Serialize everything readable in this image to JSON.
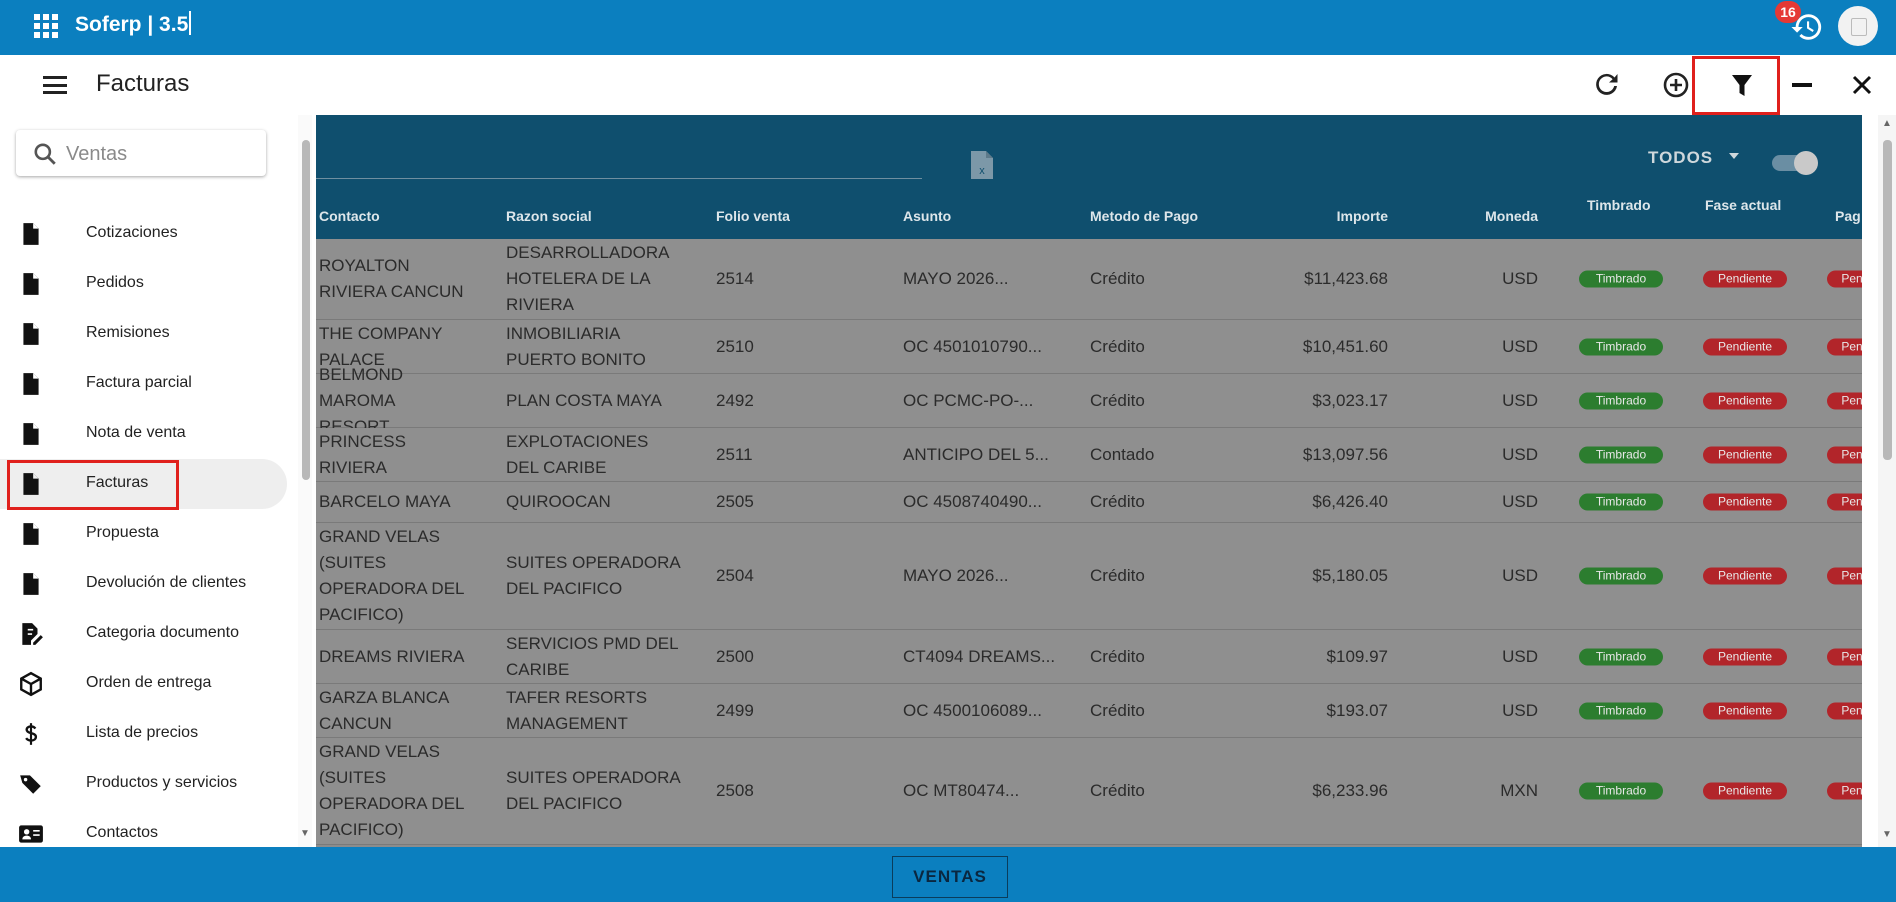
{
  "app": {
    "title": "Soferp | 3.5",
    "notification_count": "16"
  },
  "page": {
    "title": "Facturas"
  },
  "toolbar": {
    "icons": [
      "refresh-icon",
      "add-circle-icon",
      "filter-icon",
      "minimize-icon",
      "close-icon"
    ]
  },
  "sidebar": {
    "search_placeholder": "Ventas",
    "items": [
      {
        "label": "Cotizaciones",
        "icon": "document-icon"
      },
      {
        "label": "Pedidos",
        "icon": "document-icon"
      },
      {
        "label": "Remisiones",
        "icon": "document-icon"
      },
      {
        "label": "Factura parcial",
        "icon": "document-icon"
      },
      {
        "label": "Nota de venta",
        "icon": "document-icon"
      },
      {
        "label": "Facturas",
        "icon": "document-icon",
        "active": true
      },
      {
        "label": "Propuesta",
        "icon": "document-icon"
      },
      {
        "label": "Devolución de clientes",
        "icon": "document-icon"
      },
      {
        "label": "Categoria documento",
        "icon": "edit-document-icon"
      },
      {
        "label": "Orden de entrega",
        "icon": "package-icon"
      },
      {
        "label": "Lista de precios",
        "icon": "dollar-icon"
      },
      {
        "label": "Productos y servicios",
        "icon": "tags-icon"
      },
      {
        "label": "Contactos",
        "icon": "contact-card-icon"
      }
    ]
  },
  "table": {
    "filter_label": "TODOS",
    "columns": [
      "Contacto",
      "Razon social",
      "Folio venta",
      "Asunto",
      "Metodo de Pago",
      "Importe",
      "Moneda",
      "Timbrado",
      "Fase actual",
      "Pag"
    ],
    "rows": [
      [
        "ROYALTON RIVIERA CANCUN",
        "DESARROLLADORA HOTELERA DE LA RIVIERA",
        "2514",
        "MAYO 2026...",
        "Crédito",
        "$11,423.68",
        "USD",
        "Timbrado",
        "Pendiente",
        "Pen"
      ],
      [
        "THE COMPANY PALACE",
        "INMOBILIARIA PUERTO BONITO",
        "2510",
        "OC 4501010790...",
        "Crédito",
        "$10,451.60",
        "USD",
        "Timbrado",
        "Pendiente",
        "Pen"
      ],
      [
        "BELMOND MAROMA RESORT",
        "PLAN COSTA MAYA",
        "2492",
        "OC PCMC-PO-...",
        "Crédito",
        "$3,023.17",
        "USD",
        "Timbrado",
        "Pendiente",
        "Pen"
      ],
      [
        "PRINCESS RIVIERA",
        "EXPLOTACIONES DEL CARIBE",
        "2511",
        "ANTICIPO DEL 5...",
        "Contado",
        "$13,097.56",
        "USD",
        "Timbrado",
        "Pendiente",
        "Pen"
      ],
      [
        "BARCELO MAYA",
        "QUIROOCAN",
        "2505",
        "OC 4508740490...",
        "Crédito",
        "$6,426.40",
        "USD",
        "Timbrado",
        "Pendiente",
        "Pen"
      ],
      [
        "GRAND VELAS (SUITES OPERADORA DEL PACIFICO)",
        "SUITES OPERADORA DEL PACIFICO",
        "2504",
        "MAYO 2026...",
        "Crédito",
        "$5,180.05",
        "USD",
        "Timbrado",
        "Pendiente",
        "Pen"
      ],
      [
        "DREAMS RIVIERA",
        "SERVICIOS PMD DEL CARIBE",
        "2500",
        "CT4094 DREAMS...",
        "Crédito",
        "$109.97",
        "USD",
        "Timbrado",
        "Pendiente",
        "Pen"
      ],
      [
        "GARZA BLANCA CANCUN",
        "TAFER RESORTS MANAGEMENT",
        "2499",
        "OC 4500106089...",
        "Crédito",
        "$193.07",
        "USD",
        "Timbrado",
        "Pendiente",
        "Pen"
      ],
      [
        "GRAND VELAS (SUITES OPERADORA DEL PACIFICO)",
        "SUITES OPERADORA DEL PACIFICO",
        "2508",
        "OC MT80474...",
        "Crédito",
        "$6,233.96",
        "MXN",
        "Timbrado",
        "Pendiente",
        "Pen"
      ]
    ]
  },
  "footer": {
    "module_label": "VENTAS"
  },
  "colors": {
    "primary": "#0b7fbf",
    "header_dark": "#0f4f6e",
    "timbrado": "#2c7d2f",
    "pendiente": "#b2252a",
    "highlight": "#e0201c"
  }
}
